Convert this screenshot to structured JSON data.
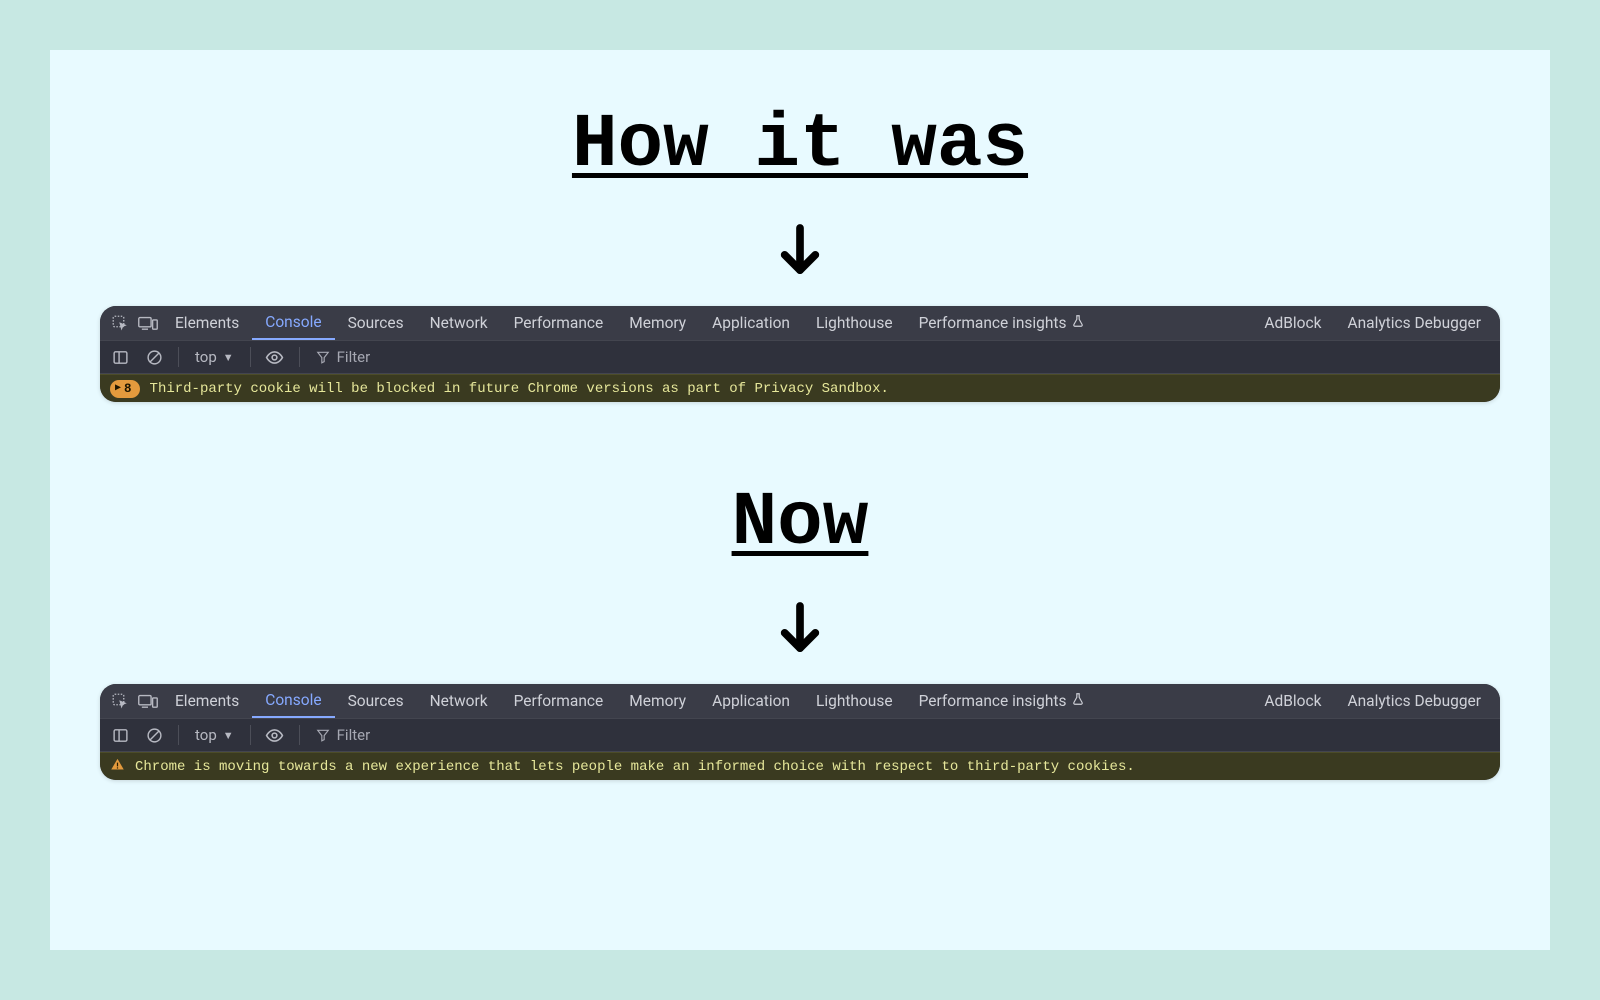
{
  "headings": {
    "before": "How it was",
    "after": "Now"
  },
  "tabs": [
    "Elements",
    "Console",
    "Sources",
    "Network",
    "Performance",
    "Memory",
    "Application",
    "Lighthouse",
    "Performance insights",
    "AdBlock",
    "Analytics Debugger"
  ],
  "active_tab": "Console",
  "toolbar": {
    "context_label": "top",
    "filter_placeholder": "Filter"
  },
  "before_panel": {
    "badge_count": "8",
    "message": "Third-party cookie will be blocked in future Chrome versions as part of Privacy Sandbox."
  },
  "after_panel": {
    "message": "Chrome is moving towards a new experience that lets people make an informed choice with respect to third-party cookies."
  }
}
